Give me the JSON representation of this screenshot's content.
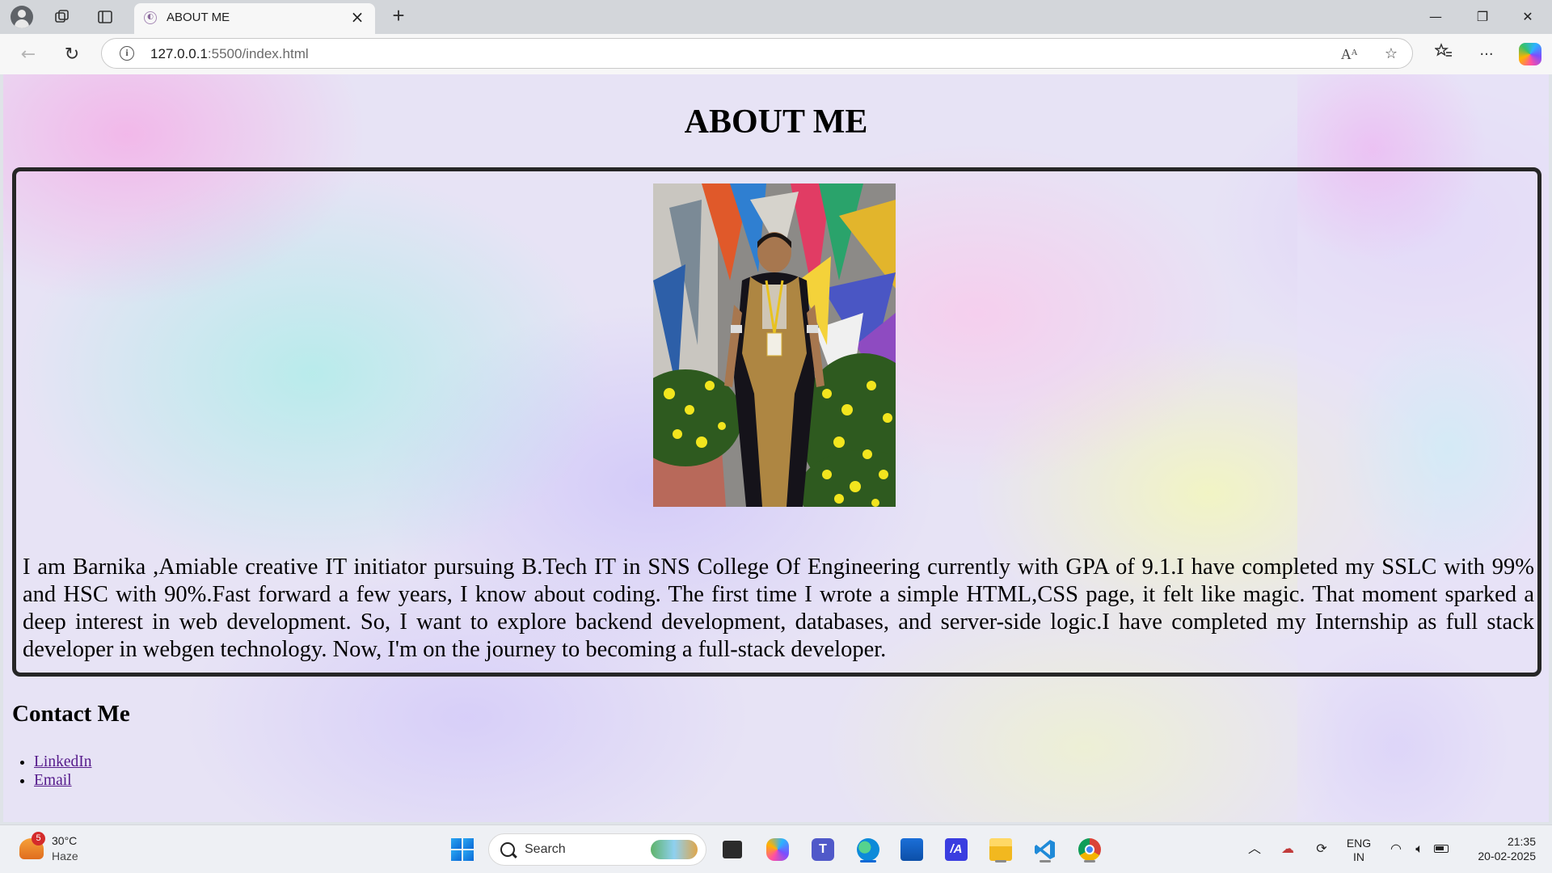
{
  "browser": {
    "tab_title": "ABOUT ME",
    "tab_close": "×",
    "new_tab": "+",
    "url_host": "127.0.0.1",
    "url_path": ":5500/index.html",
    "read_aloud_label": "Aᴬ",
    "window_controls": [
      "—",
      "❐",
      "✕"
    ]
  },
  "page": {
    "title": "ABOUT ME",
    "photo_description_icon": "profile-photo",
    "about_text": "I am Barnika ,Amiable creative IT initiator pursuing B.Tech IT in SNS College Of Engineering currently with GPA of 9.1.I have completed my SSLC with 99% and HSC with 90%.Fast forward a few years, I know about coding. The first time I wrote a simple HTML,CSS page, it felt like magic. That moment sparked a deep interest in web development. So, I want to explore backend development, databases, and server-side logic.I have completed my Internship as full stack developer in webgen technology. Now, I'm on the journey to becoming a full-stack developer.",
    "contact_heading": "Contact Me",
    "contact_links": [
      "LinkedIn",
      "Email"
    ]
  },
  "taskbar": {
    "weather_badge": "5",
    "weather_temp": "30°C",
    "weather_desc": "Haze",
    "search_label": "Search",
    "lang_top": "ENG",
    "lang_bottom": "IN",
    "time": "21:35",
    "date": "20-02-2025"
  },
  "colors": {
    "link": "#551a8b",
    "box_border": "#262626",
    "edge_accent": "#0a69d6"
  }
}
